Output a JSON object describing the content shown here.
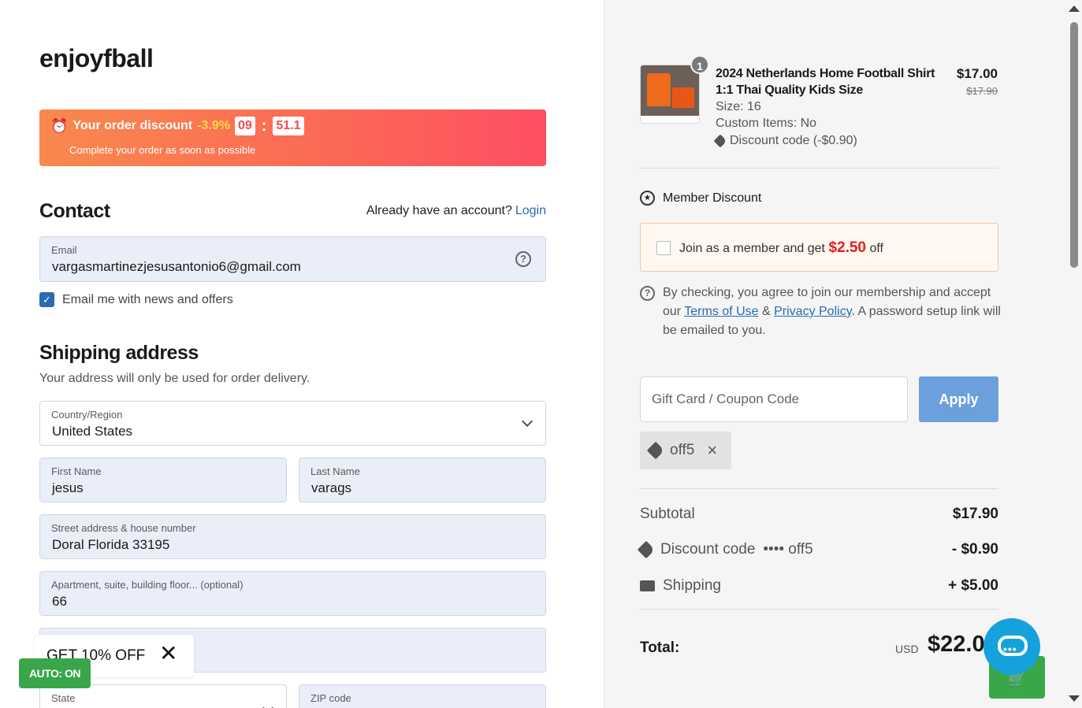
{
  "store": {
    "name": "enjoyfball"
  },
  "banner": {
    "label": "Your order discount",
    "percent": "-3.9%",
    "minutes": "09",
    "seconds": "51.1",
    "subtitle": "Complete your order as soon as possible"
  },
  "contact": {
    "title": "Contact",
    "account_prompt": "Already have an account?",
    "login_label": "Login",
    "email_label": "Email",
    "email_value": "vargasmartinezjesusantonio6@gmail.com",
    "news_label": "Email me with news and offers",
    "news_checked": true
  },
  "shipping": {
    "title": "Shipping address",
    "subtitle": "Your address will only be used for order delivery.",
    "country_label": "Country/Region",
    "country_value": "United States",
    "first_name_label": "First Name",
    "first_name_value": "jesus",
    "last_name_label": "Last Name",
    "last_name_value": "varags",
    "street_label": "Street address & house number",
    "street_value": "Doral Florida 33195",
    "apt_label": "Apartment, suite, building floor... (optional)",
    "apt_value": "66",
    "state_label": "State",
    "zip_label": "ZIP code"
  },
  "promo": {
    "text": "GET 10% OFF",
    "auto": "AUTO: ON"
  },
  "order": {
    "item": {
      "quantity": "1",
      "name": "2024 Netherlands Home Football Shirt 1:1 Thai Quality Kids Size",
      "size": "Size: 16",
      "custom": "Custom Items: No",
      "discount": "Discount code (-$0.90)",
      "price": "$17.00",
      "old_price": "$17.90"
    },
    "member": {
      "title": "Member Discount",
      "join_text": "Join as a member and get",
      "amount": "$2.50",
      "off": "off",
      "terms_pre": "By checking, you agree to join our membership and accept our",
      "terms_link": "Terms of Use",
      "amp": "&",
      "privacy_link": "Privacy Policy",
      "terms_post": ". A password setup link will be emailed to you."
    },
    "coupon": {
      "placeholder": "Gift Card / Coupon Code",
      "apply_label": "Apply",
      "applied": "off5"
    },
    "summary": {
      "subtotal_label": "Subtotal",
      "subtotal_value": "$17.90",
      "discount_label": "Discount code",
      "discount_code": "•••• off5",
      "discount_value": "- $0.90",
      "shipping_label": "Shipping",
      "shipping_value": "+ $5.00",
      "total_label": "Total:",
      "currency": "USD",
      "total_value": "$22.0"
    }
  },
  "colors": {
    "accent": "#2a6ab3",
    "apply": "#6ca0dc",
    "banner_start": "#f9894d",
    "banner_end": "#fd4f62",
    "green": "#3aa64a",
    "chat": "#15a2dc"
  }
}
